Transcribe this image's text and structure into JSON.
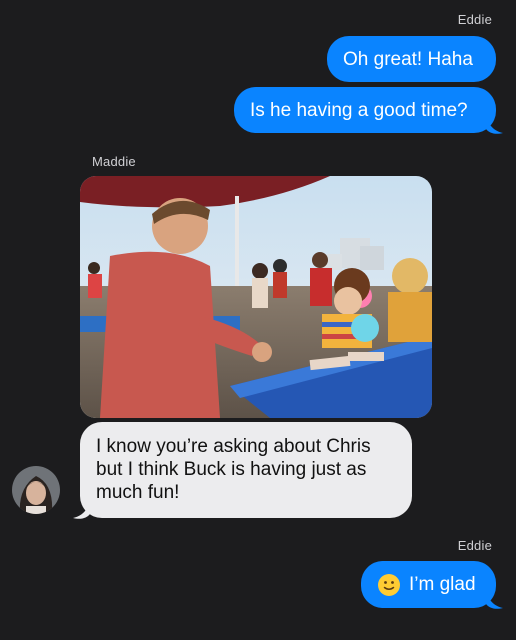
{
  "messages": {
    "eddie_name_1": "Eddie",
    "msg1": "Oh great! Haha",
    "msg2": "Is he having a good time?",
    "maddie_name": "Maddie",
    "photo_icon": "photo",
    "msg3": "I know you’re asking about Chris but I think Buck is having just as much fun!",
    "eddie_name_2": "Eddie",
    "msg4": "I’m glad",
    "msg4_emoji": "slightly-smiling-face"
  },
  "colors": {
    "background": "#1c1c1e",
    "outgoing_bubble": "#0a84ff",
    "incoming_bubble": "#ececee"
  }
}
